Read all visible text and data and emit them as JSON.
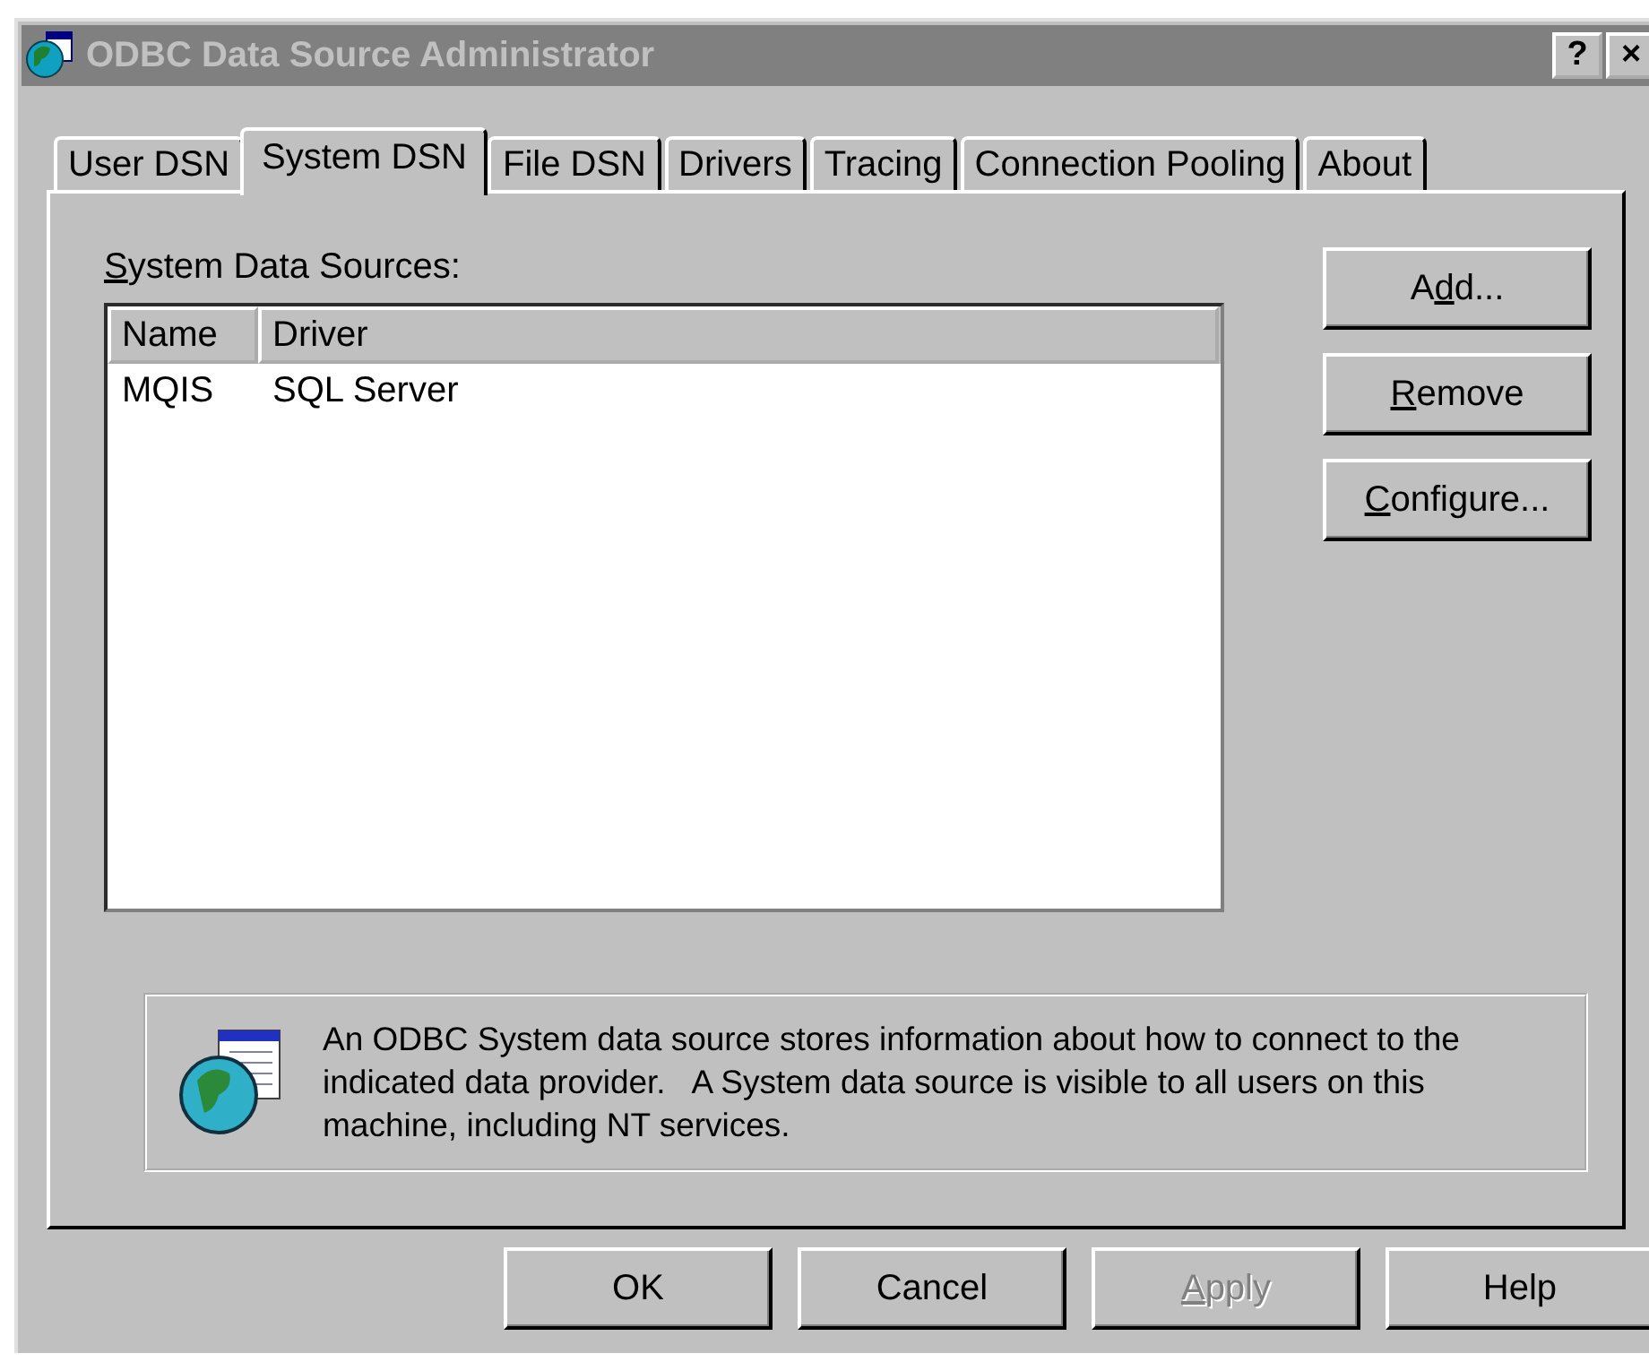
{
  "window": {
    "title": "ODBC Data Source Administrator",
    "title_buttons": [
      "?",
      "×"
    ]
  },
  "tabs": [
    {
      "label": "User DSN",
      "selected": false
    },
    {
      "label": "System DSN",
      "selected": true
    },
    {
      "label": "File DSN",
      "selected": false
    },
    {
      "label": "Drivers",
      "selected": false
    },
    {
      "label": "Tracing",
      "selected": false
    },
    {
      "label": "Connection Pooling",
      "selected": false
    },
    {
      "label": "About",
      "selected": false
    }
  ],
  "list_label": {
    "key": "S",
    "post": "ystem Data Sources:"
  },
  "list": {
    "columns": [
      "Name",
      "Driver"
    ],
    "rows": [
      {
        "cells": [
          "MQIS",
          "SQL Server"
        ],
        "selected": false
      }
    ]
  },
  "side_buttons": [
    {
      "pre": "A",
      "key": "d",
      "post": "d...",
      "disabled": false
    },
    {
      "key": "R",
      "post": "emove",
      "disabled": false
    },
    {
      "key": "C",
      "post": "onfigure...",
      "disabled": false
    }
  ],
  "info": "An ODBC System data source stores information about how to connect to the indicated data provider.   A System data source is visible to all users on this machine, including NT services.",
  "bottom_buttons": [
    {
      "pre": "OK",
      "disabled": false
    },
    {
      "pre": "Cancel",
      "disabled": false
    },
    {
      "key": "A",
      "post": "pply",
      "disabled": true
    },
    {
      "pre": "Help",
      "disabled": false
    }
  ]
}
